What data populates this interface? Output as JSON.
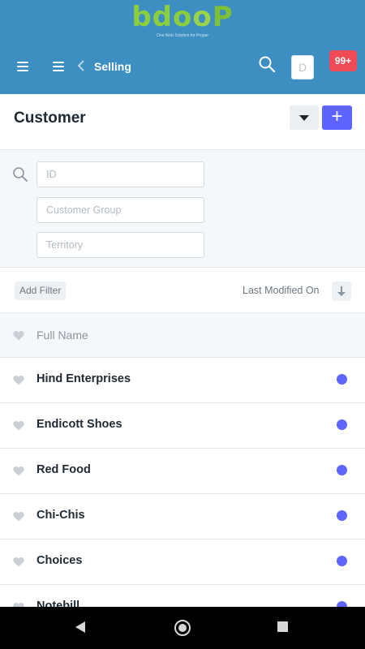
{
  "brand": {
    "logo_b": "b",
    "logo_do": "do",
    "logo_o": "o",
    "logo_p": "P",
    "tagline": "One Web Solution for Proper"
  },
  "navbar": {
    "breadcrumb": "Selling",
    "avatar_initial": "D",
    "notification_count": "99+",
    "icons": [
      "menu-icon",
      "menu-icon",
      "chevron-left-icon",
      "search-icon"
    ],
    "colors": {
      "bar": "#3e8fc1",
      "badge": "#ef4b56"
    }
  },
  "page": {
    "title": "Customer",
    "add_label": "+"
  },
  "filters": {
    "fields": [
      {
        "placeholder": "ID"
      },
      {
        "placeholder": "Customer Group"
      },
      {
        "placeholder": "Territory"
      }
    ],
    "add_filter_label": "Add Filter",
    "sort_label": "Last Modified On"
  },
  "list": {
    "header_label": "Full Name",
    "status_color": "#5e64ff",
    "rows": [
      {
        "name": "Hind Enterprises"
      },
      {
        "name": "Endicott Shoes"
      },
      {
        "name": "Red Food"
      },
      {
        "name": "Chi-Chis"
      },
      {
        "name": "Choices"
      },
      {
        "name": "Notebill"
      }
    ]
  }
}
